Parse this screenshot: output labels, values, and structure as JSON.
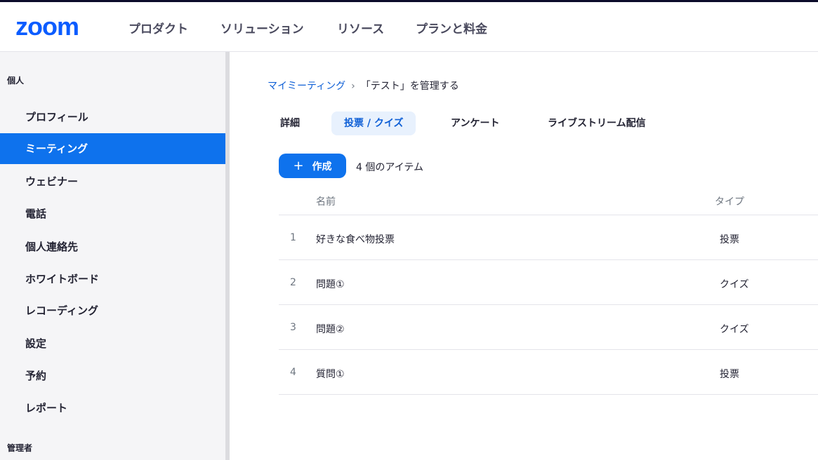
{
  "header": {
    "logo": "zoom",
    "nav": [
      "プロダクト",
      "ソリューション",
      "リソース",
      "プランと料金"
    ]
  },
  "sidebar": {
    "section_personal": "個人",
    "items": [
      {
        "label": "プロフィール",
        "active": false
      },
      {
        "label": "ミーティング",
        "active": true
      },
      {
        "label": "ウェビナー",
        "active": false
      },
      {
        "label": "電話",
        "active": false
      },
      {
        "label": "個人連絡先",
        "active": false
      },
      {
        "label": "ホワイトボード",
        "active": false
      },
      {
        "label": "レコーディング",
        "active": false
      },
      {
        "label": "設定",
        "active": false
      },
      {
        "label": "予約",
        "active": false
      },
      {
        "label": "レポート",
        "active": false
      }
    ],
    "section_admin": "管理者"
  },
  "breadcrumb": {
    "link": "マイミーティング",
    "separator": "›",
    "current": "「テスト」を管理する"
  },
  "tabs": [
    {
      "label": "詳細",
      "active": false
    },
    {
      "label": "投票 / クイズ",
      "active": true
    },
    {
      "label": "アンケート",
      "active": false
    },
    {
      "label": "ライブストリーム配信",
      "active": false
    }
  ],
  "toolbar": {
    "create_icon": "+",
    "create_label": "作成",
    "item_count": "4 個のアイテム"
  },
  "table": {
    "headers": {
      "name": "名前",
      "type": "タイプ"
    },
    "rows": [
      {
        "index": "1",
        "name": "好きな食べ物投票",
        "type": "投票"
      },
      {
        "index": "2",
        "name": "問題①",
        "type": "クイズ"
      },
      {
        "index": "3",
        "name": "問題②",
        "type": "クイズ"
      },
      {
        "index": "4",
        "name": "質問①",
        "type": "投票"
      }
    ]
  },
  "colors": {
    "brand": "#0b5cff",
    "accent": "#0e72ed",
    "tab_active_bg": "#e8f1fd"
  }
}
